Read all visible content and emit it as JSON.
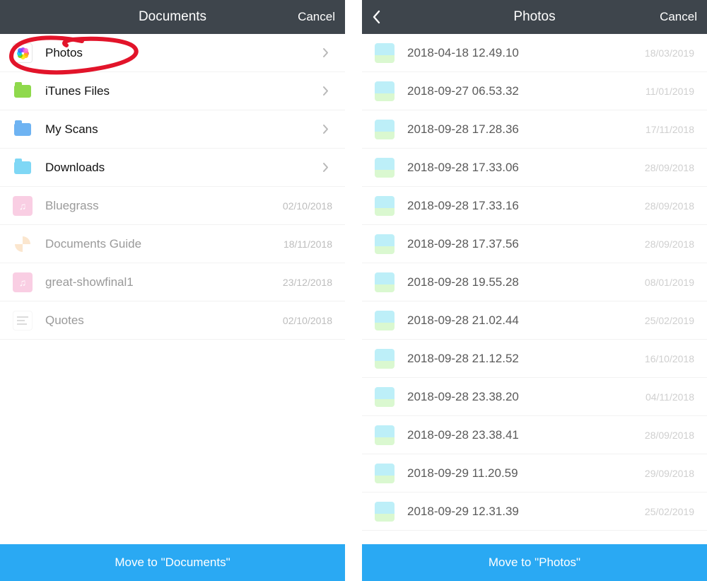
{
  "left": {
    "header": {
      "title": "Documents",
      "cancel": "Cancel"
    },
    "items": [
      {
        "label": "Photos",
        "icon": "photos-app",
        "chevron": true
      },
      {
        "label": "iTunes Files",
        "icon": "folder-green",
        "chevron": true
      },
      {
        "label": "My Scans",
        "icon": "folder-blue",
        "chevron": true
      },
      {
        "label": "Downloads",
        "icon": "folder-cyan",
        "chevron": true
      },
      {
        "label": "Bluegrass",
        "icon": "music-pink",
        "date": "02/10/2018",
        "faded": true
      },
      {
        "label": "Documents Guide",
        "icon": "help",
        "date": "18/11/2018",
        "faded": true
      },
      {
        "label": "great-showfinal1",
        "icon": "music-pink",
        "date": "23/12/2018",
        "faded": true
      },
      {
        "label": "Quotes",
        "icon": "text",
        "date": "02/10/2018",
        "faded": true
      }
    ],
    "footer": "Move to \"Documents\"",
    "annotation": "circled-photos"
  },
  "right": {
    "header": {
      "title": "Photos",
      "cancel": "Cancel",
      "back": true
    },
    "items": [
      {
        "label": "2018-04-18 12.49.10",
        "date": "18/03/2019"
      },
      {
        "label": "2018-09-27 06.53.32",
        "date": "11/01/2019"
      },
      {
        "label": "2018-09-28 17.28.36",
        "date": "17/11/2018"
      },
      {
        "label": "2018-09-28 17.33.06",
        "date": "28/09/2018"
      },
      {
        "label": "2018-09-28 17.33.16",
        "date": "28/09/2018"
      },
      {
        "label": "2018-09-28 17.37.56",
        "date": "28/09/2018"
      },
      {
        "label": "2018-09-28 19.55.28",
        "date": "08/01/2019"
      },
      {
        "label": "2018-09-28 21.02.44",
        "date": "25/02/2019"
      },
      {
        "label": "2018-09-28 21.12.52",
        "date": "16/10/2018"
      },
      {
        "label": "2018-09-28 23.38.20",
        "date": "04/11/2018"
      },
      {
        "label": "2018-09-28 23.38.41",
        "date": "28/09/2018"
      },
      {
        "label": "2018-09-29 11.20.59",
        "date": "29/09/2018"
      },
      {
        "label": "2018-09-29 12.31.39",
        "date": "25/02/2019"
      }
    ],
    "footer": "Move to \"Photos\""
  }
}
